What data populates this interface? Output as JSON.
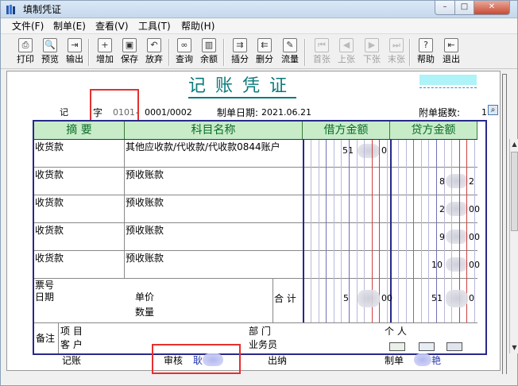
{
  "window": {
    "title": "填制凭证",
    "min": "–",
    "max": "□",
    "close": "✕"
  },
  "menu": [
    "文件(F)",
    "制单(E)",
    "查看(V)",
    "工具(T)",
    "帮助(H)"
  ],
  "toolbar": [
    {
      "label": "打印",
      "icon": "print-icon",
      "glyph": "⎙",
      "enabled": true
    },
    {
      "label": "预览",
      "icon": "preview-icon",
      "glyph": "🔍",
      "enabled": true
    },
    {
      "label": "输出",
      "icon": "export-icon",
      "glyph": "⇥",
      "enabled": true
    },
    {
      "label": "增加",
      "icon": "add-icon",
      "glyph": "+",
      "enabled": true
    },
    {
      "label": "保存",
      "icon": "save-icon",
      "glyph": "▣",
      "enabled": true
    },
    {
      "label": "放弃",
      "icon": "undo-icon",
      "glyph": "↶",
      "enabled": true
    },
    {
      "label": "查询",
      "icon": "binoculars-icon",
      "glyph": "∞",
      "enabled": true
    },
    {
      "label": "余额",
      "icon": "balance-chart-icon",
      "glyph": "▥",
      "enabled": true
    },
    {
      "label": "插分",
      "icon": "insert-row-icon",
      "glyph": "⇉",
      "enabled": true
    },
    {
      "label": "删分",
      "icon": "delete-row-icon",
      "glyph": "⇇",
      "enabled": true
    },
    {
      "label": "流量",
      "icon": "flow-icon",
      "glyph": "✎",
      "enabled": true
    },
    {
      "label": "首张",
      "icon": "first-icon",
      "glyph": "⏮",
      "enabled": false
    },
    {
      "label": "上张",
      "icon": "prev-icon",
      "glyph": "◀",
      "enabled": false
    },
    {
      "label": "下张",
      "icon": "next-icon",
      "glyph": "▶",
      "enabled": false
    },
    {
      "label": "末张",
      "icon": "last-icon",
      "glyph": "⏭",
      "enabled": false
    },
    {
      "label": "帮助",
      "icon": "help-icon",
      "glyph": "?",
      "enabled": true
    },
    {
      "label": "退出",
      "icon": "exit-icon",
      "glyph": "⇤",
      "enabled": true
    }
  ],
  "voucher": {
    "title": "记账凭证",
    "type_label": "记",
    "zi_label": "字",
    "zi_value": "0101",
    "number": "0001/0002",
    "date_label": "制单日期:",
    "date": "2021.06.21",
    "attach_label": "附单据数:",
    "attach_count": "1"
  },
  "grid": {
    "headers": [
      "摘 要",
      "科目名称",
      "借方金额",
      "贷方金额"
    ],
    "rows": [
      {
        "summary": "收货款",
        "account": "其他应收款/代收款/代收款0844账户",
        "debit": "51",
        "debit_tail": "0",
        "credit": "",
        "credit_tail": ""
      },
      {
        "summary": "收货款",
        "account": "预收账款",
        "debit": "",
        "debit_tail": "",
        "credit": "8",
        "credit_tail": "2"
      },
      {
        "summary": "收货款",
        "account": "预收账款",
        "debit": "",
        "debit_tail": "",
        "credit": "2",
        "credit_tail": "00"
      },
      {
        "summary": "收货款",
        "account": "预收账款",
        "debit": "",
        "debit_tail": "",
        "credit": "9",
        "credit_tail": "00"
      },
      {
        "summary": "收货款",
        "account": "预收账款",
        "debit": "",
        "debit_tail": "",
        "credit": "10",
        "credit_tail": "00"
      }
    ],
    "footer": {
      "ticket_no": "票号",
      "date": "日期",
      "unit_price": "单价",
      "quantity": "数量",
      "total": "合 计",
      "total_debit": "5",
      "total_debit_tail": "00",
      "total_credit": "51",
      "total_credit_tail": "0"
    },
    "remark": {
      "label": "备注",
      "project": "项 目",
      "customer": "客 户",
      "department": "部 门",
      "clerk": "业务员",
      "person": "个 人"
    }
  },
  "signatures": {
    "bookkeeping": "记账",
    "review": "审核",
    "review_name": "耿",
    "cashier": "出纳",
    "maker": "制单",
    "maker_name": "艳"
  },
  "colors": {
    "title": "#0a7a7a",
    "header_bg": "#c8ecc8",
    "grid_border": "#28288a",
    "highlight": "#e53030"
  }
}
